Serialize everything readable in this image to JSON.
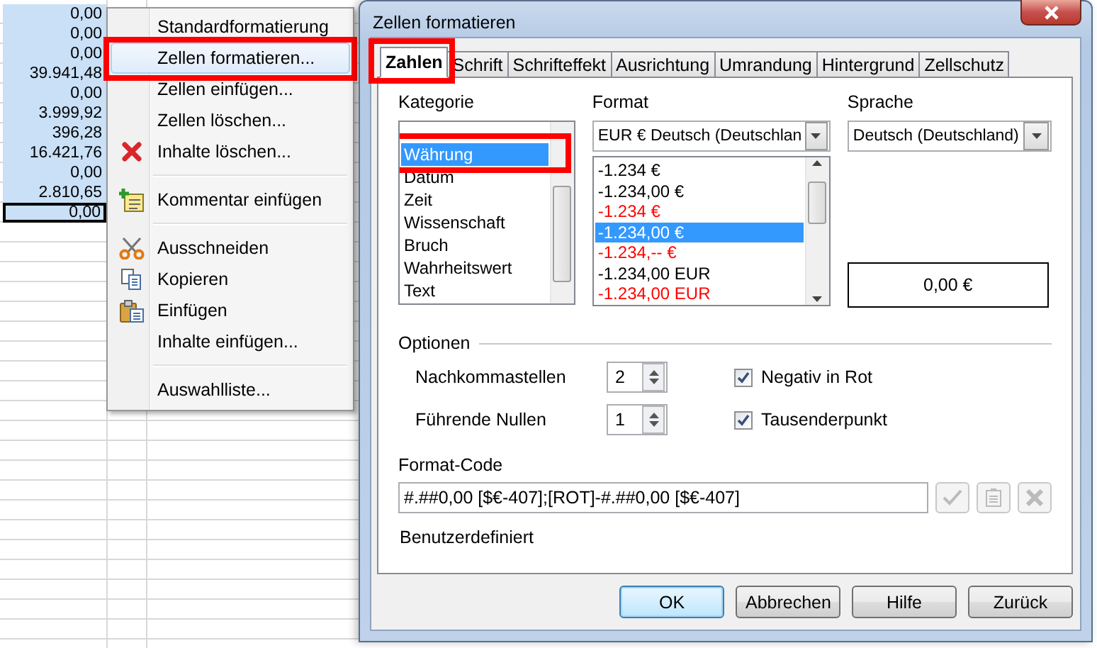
{
  "sheet": {
    "cells": [
      {
        "value": "0,00",
        "selected": true,
        "current": false
      },
      {
        "value": "0,00",
        "selected": true,
        "current": false
      },
      {
        "value": "0,00",
        "selected": true,
        "current": false
      },
      {
        "value": "39.941,48",
        "selected": true,
        "current": false
      },
      {
        "value": "0,00",
        "selected": true,
        "current": false
      },
      {
        "value": "3.999,92",
        "selected": true,
        "current": false
      },
      {
        "value": "396,28",
        "selected": true,
        "current": false
      },
      {
        "value": "16.421,76",
        "selected": true,
        "current": false
      },
      {
        "value": "0,00",
        "selected": true,
        "current": false
      },
      {
        "value": "2.810,65",
        "selected": true,
        "current": false
      },
      {
        "value": "0,00",
        "selected": true,
        "current": true
      }
    ]
  },
  "context_menu": {
    "items": [
      {
        "kind": "item",
        "label": "Standardformatierung",
        "hovered": false,
        "marked": false
      },
      {
        "kind": "item",
        "label": "Zellen formatieren...",
        "hovered": true,
        "marked": true
      },
      {
        "kind": "item",
        "label": "Zellen einfügen...",
        "hovered": false,
        "marked": false
      },
      {
        "kind": "item",
        "label": "Zellen löschen...",
        "hovered": false,
        "marked": false
      },
      {
        "kind": "item",
        "label": "Inhalte löschen...",
        "hovered": false,
        "marked": false
      },
      {
        "kind": "separator"
      },
      {
        "kind": "item",
        "label": "Kommentar einfügen",
        "hovered": false,
        "marked": false
      },
      {
        "kind": "separator"
      },
      {
        "kind": "item",
        "label": "Ausschneiden",
        "hovered": false,
        "marked": false
      },
      {
        "kind": "item",
        "label": "Kopieren",
        "hovered": false,
        "marked": false
      },
      {
        "kind": "item",
        "label": "Einfügen",
        "hovered": false,
        "marked": false
      },
      {
        "kind": "item",
        "label": "Inhalte einfügen...",
        "hovered": false,
        "marked": false
      },
      {
        "kind": "separator"
      },
      {
        "kind": "item",
        "label": "Auswahlliste...",
        "hovered": false,
        "marked": false
      }
    ]
  },
  "dialog": {
    "title": "Zellen formatieren",
    "tabs": [
      {
        "label": "Zahlen",
        "selected": true,
        "marked": true
      },
      {
        "label": "Schrift",
        "selected": false,
        "marked": false
      },
      {
        "label": "Schrifteffekt",
        "selected": false,
        "marked": false
      },
      {
        "label": "Ausrichtung",
        "selected": false,
        "marked": false
      },
      {
        "label": "Umrandung",
        "selected": false,
        "marked": false
      },
      {
        "label": "Hintergrund",
        "selected": false,
        "marked": false
      },
      {
        "label": "Zellschutz",
        "selected": false,
        "marked": false
      }
    ],
    "category": {
      "label": "Kategorie",
      "items": [
        {
          "label": "Währung",
          "selected": true,
          "marked": true
        },
        {
          "label": "Datum",
          "selected": false,
          "marked": false
        },
        {
          "label": "Zeit",
          "selected": false,
          "marked": false
        },
        {
          "label": "Wissenschaft",
          "selected": false,
          "marked": false
        },
        {
          "label": "Bruch",
          "selected": false,
          "marked": false
        },
        {
          "label": "Wahrheitswert",
          "selected": false,
          "marked": false
        },
        {
          "label": "Text",
          "selected": false,
          "marked": false
        }
      ]
    },
    "format": {
      "label": "Format",
      "value": "EUR € Deutsch (Deutschlan",
      "items": [
        {
          "label": "-1.234 €",
          "red": false,
          "selected": false
        },
        {
          "label": "-1.234,00 €",
          "red": false,
          "selected": false
        },
        {
          "label": "-1.234 €",
          "red": true,
          "selected": false
        },
        {
          "label": "-1.234,00 €",
          "red": false,
          "selected": true
        },
        {
          "label": "-1.234,-- €",
          "red": true,
          "selected": false
        },
        {
          "label": "-1.234,00 EUR",
          "red": false,
          "selected": false
        },
        {
          "label": "-1.234,00 EUR",
          "red": true,
          "selected": false
        }
      ]
    },
    "language": {
      "label": "Sprache",
      "value": "Deutsch (Deutschland)"
    },
    "preview": "0,00 €",
    "options": {
      "label": "Optionen",
      "spins": [
        {
          "label": "Nachkommastellen",
          "value": "2"
        },
        {
          "label": "Führende Nullen",
          "value": "1"
        }
      ],
      "checks": [
        {
          "label": "Negativ in Rot",
          "checked": true
        },
        {
          "label": "Tausenderpunkt",
          "checked": true
        }
      ]
    },
    "format_code": {
      "label": "Format-Code",
      "value": "#.##0,00 [$€-407];[ROT]-#.##0,00 [$€-407]",
      "note": "Benutzerdefiniert"
    },
    "buttons": [
      {
        "label": "OK",
        "default": true
      },
      {
        "label": "Abbrechen",
        "default": false
      },
      {
        "label": "Hilfe",
        "default": false
      },
      {
        "label": "Zurück",
        "default": false
      }
    ]
  }
}
